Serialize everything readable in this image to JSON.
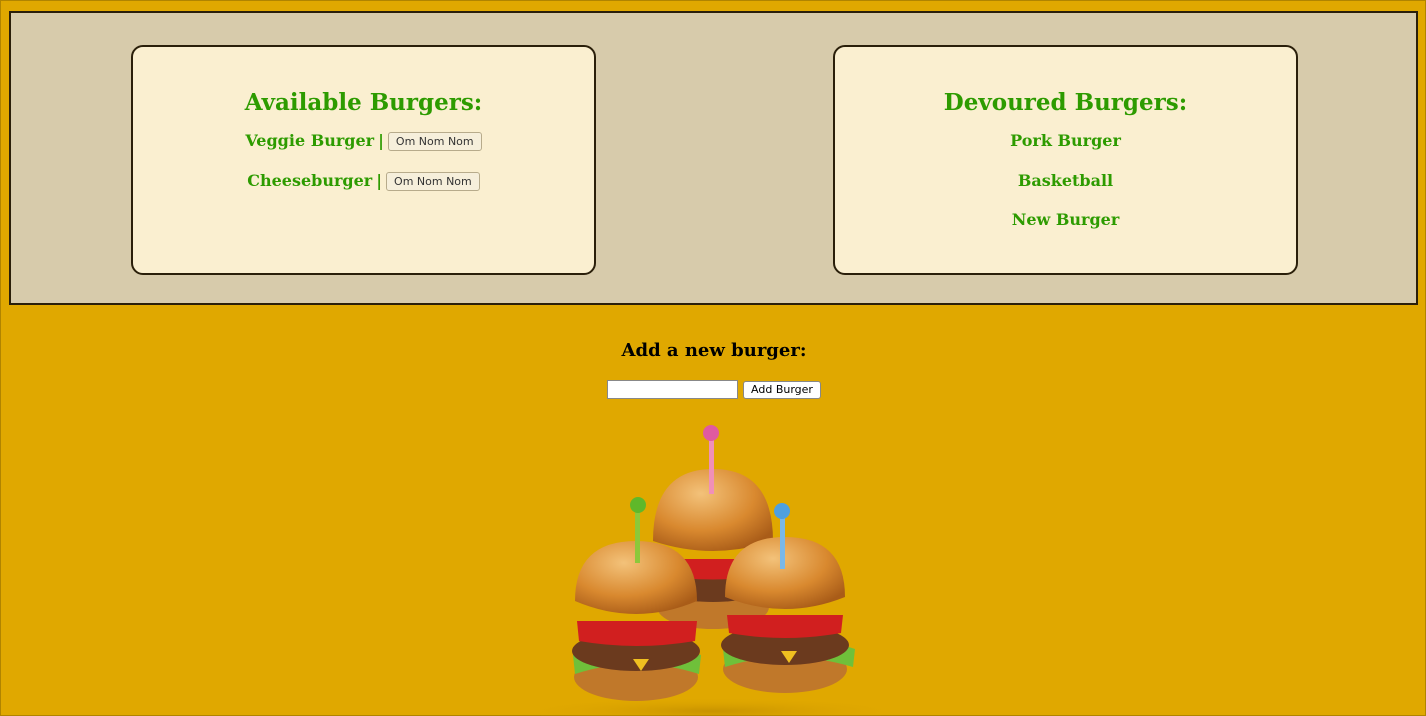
{
  "available": {
    "heading": "Available Burgers:",
    "items": [
      {
        "name": "Veggie Burger",
        "separator": "|",
        "button": "Om Nom Nom"
      },
      {
        "name": "Cheeseburger",
        "separator": "|",
        "button": "Om Nom Nom"
      }
    ]
  },
  "devoured": {
    "heading": "Devoured Burgers:",
    "items": [
      "Pork Burger",
      "Basketball",
      "New Burger"
    ]
  },
  "add_form": {
    "heading": "Add a new burger:",
    "input_value": "",
    "button": "Add Burger"
  },
  "colors": {
    "background": "#e0a800",
    "panel": "#d7cbab",
    "card": "#faefd0",
    "text_accent": "#2d9b00"
  },
  "illustration": {
    "icon": "burgers-illustration",
    "pick_colors": [
      "#e05aa0",
      "#5fb82a",
      "#4fa0e0"
    ]
  }
}
